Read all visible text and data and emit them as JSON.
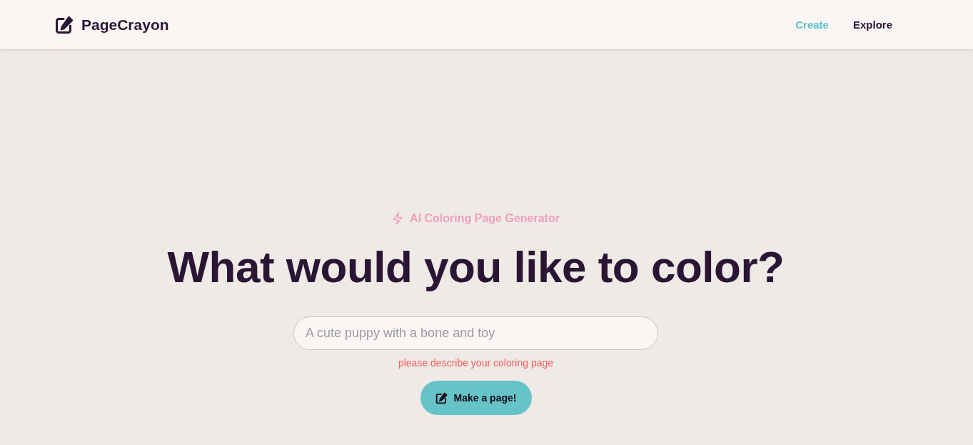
{
  "header": {
    "logo": {
      "text": "PageCrayon"
    },
    "nav": [
      {
        "label": "Create",
        "selected": true
      },
      {
        "label": "Explore",
        "selected": false
      }
    ]
  },
  "hero": {
    "badge": "AI Coloring Page Generator",
    "heading": "What would you like to color?",
    "prompt_field": {
      "placeholder": "A cute puppy with a bone and toy"
    },
    "error": "please describe your coloring page",
    "submit_button": "Make a page!"
  }
}
